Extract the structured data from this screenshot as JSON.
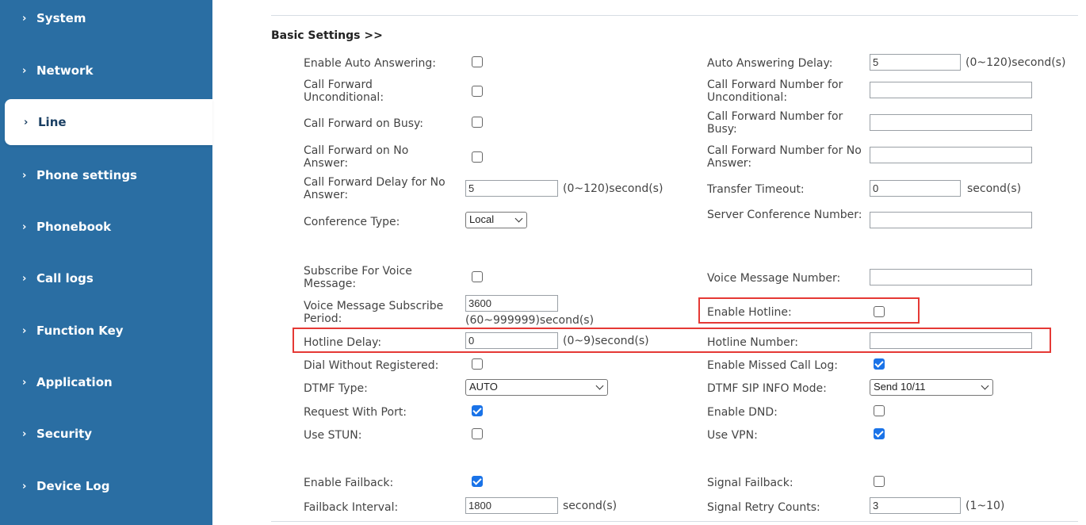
{
  "sidebar": {
    "items": [
      {
        "label": "System"
      },
      {
        "label": "Network"
      },
      {
        "label": "Line"
      },
      {
        "label": "Phone settings"
      },
      {
        "label": "Phonebook"
      },
      {
        "label": "Call logs"
      },
      {
        "label": "Function Key"
      },
      {
        "label": "Application"
      },
      {
        "label": "Security"
      },
      {
        "label": "Device Log"
      }
    ],
    "active": "Line",
    "bg_color": "#2a6ea3"
  },
  "section": {
    "title": "Basic Settings >>"
  },
  "fields": {
    "auto_answer": {
      "label": "Enable Auto Answering:",
      "checked": false
    },
    "auto_answer_delay": {
      "label": "Auto Answering Delay:",
      "value": "5",
      "unit": "(0~120)second(s)"
    },
    "cf_uncond": {
      "label": "Call Forward Unconditional:",
      "checked": false
    },
    "cf_uncond_num": {
      "label": "Call Forward Number for Unconditional:",
      "value": ""
    },
    "cf_busy": {
      "label": "Call Forward on Busy:",
      "checked": false
    },
    "cf_busy_num": {
      "label": "Call Forward Number for Busy:",
      "value": ""
    },
    "cf_noans": {
      "label": "Call Forward on No Answer:",
      "checked": false
    },
    "cf_noans_num": {
      "label": "Call Forward Number for No Answer:",
      "value": ""
    },
    "cf_noans_delay": {
      "label": "Call Forward Delay for No Answer:",
      "value": "5",
      "unit": "(0~120)second(s)"
    },
    "transfer_timeout": {
      "label": "Transfer Timeout:",
      "value": "0",
      "unit": "second(s)"
    },
    "conf_type": {
      "label": "Conference Type:",
      "value": "Local"
    },
    "server_conf_num": {
      "label": "Server Conference Number:",
      "value": ""
    },
    "sub_vm": {
      "label": "Subscribe For Voice Message:",
      "checked": false
    },
    "vm_number": {
      "label": "Voice Message Number:",
      "value": ""
    },
    "vm_sub_period": {
      "label": "Voice Message Subscribe Period:",
      "value": "3600",
      "unit": "(60~999999)second(s)"
    },
    "hotline": {
      "label": "Enable Hotline:",
      "checked": false
    },
    "hotline_delay": {
      "label": "Hotline Delay:",
      "value": "0",
      "unit": "(0~9)second(s)"
    },
    "hotline_number": {
      "label": "Hotline Number:",
      "value": ""
    },
    "dial_unreg": {
      "label": "Dial Without Registered:",
      "checked": false
    },
    "missed_log": {
      "label": "Enable Missed Call Log:",
      "checked": true
    },
    "dtmf_type": {
      "label": "DTMF Type:",
      "value": "AUTO"
    },
    "dtmf_sip": {
      "label": "DTMF SIP INFO Mode:",
      "value": "Send 10/11"
    },
    "req_port": {
      "label": "Request With Port:",
      "checked": true
    },
    "dnd": {
      "label": "Enable DND:",
      "checked": false
    },
    "stun": {
      "label": "Use STUN:",
      "checked": false
    },
    "vpn": {
      "label": "Use VPN:",
      "checked": true
    },
    "failback": {
      "label": "Enable Failback:",
      "checked": true
    },
    "signal_failback": {
      "label": "Signal Failback:",
      "checked": false
    },
    "failback_interval": {
      "label": "Failback Interval:",
      "value": "1800",
      "unit": "second(s)"
    },
    "retry_counts": {
      "label": "Signal Retry Counts:",
      "value": "3",
      "unit": "(1~10)"
    }
  },
  "colors": {
    "checkbox_on": "#1a73e8",
    "highlight": "#e53935"
  }
}
